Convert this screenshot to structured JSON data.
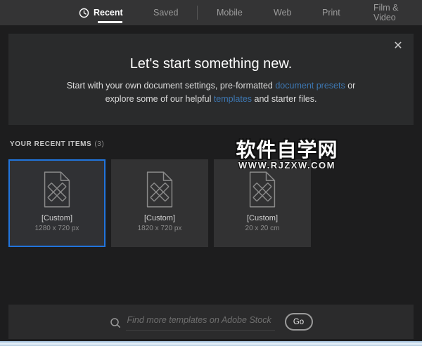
{
  "tabs": {
    "items": [
      {
        "label": "Recent"
      },
      {
        "label": "Saved"
      },
      {
        "label": "Mobile"
      },
      {
        "label": "Web"
      },
      {
        "label": "Print"
      },
      {
        "label": "Film & Video"
      }
    ]
  },
  "banner": {
    "close_icon": "✕",
    "title": "Let's start something new.",
    "subtitle": {
      "p1": "Start with your own document settings, pre-formatted ",
      "link1": "document presets",
      "p2": " or",
      "p3": "explore some of our helpful ",
      "link2": "templates",
      "p4": " and starter files."
    }
  },
  "recent": {
    "label": "YOUR RECENT ITEMS",
    "count": "(3)",
    "items": [
      {
        "name": "[Custom]",
        "dims": "1280 x 720 px",
        "selected": true
      },
      {
        "name": "[Custom]",
        "dims": "1820 x 720 px",
        "selected": false
      },
      {
        "name": "[Custom]",
        "dims": "20 x 20 cm",
        "selected": false
      }
    ]
  },
  "watermark": {
    "line1": "软件自学网",
    "line2": "WWW.RJZXW.COM"
  },
  "search": {
    "placeholder": "Find more templates on Adobe Stock",
    "go_label": "Go"
  },
  "colors": {
    "accent_blue": "#2174dc",
    "link_blue": "#3d77b2",
    "topbar": "#343435",
    "panel": "#2a2b2c",
    "page_bg": "#1d1d1e",
    "card_bg": "#323233"
  }
}
